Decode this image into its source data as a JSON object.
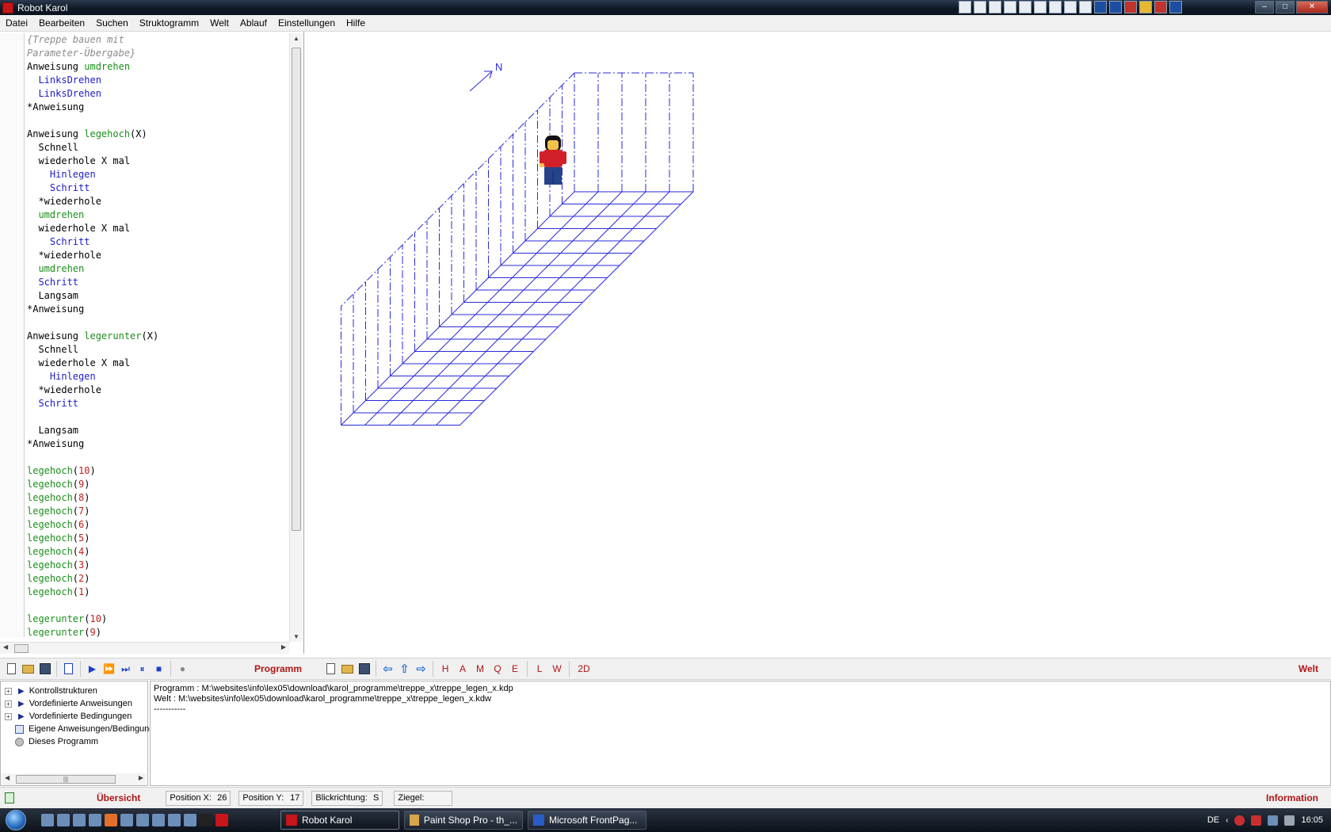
{
  "window": {
    "title": "Robot Karol"
  },
  "menu": [
    "Datei",
    "Bearbeiten",
    "Suchen",
    "Struktogramm",
    "Welt",
    "Ablauf",
    "Einstellungen",
    "Hilfe"
  ],
  "editor": {
    "lines": [
      [
        [
          "comment",
          "{Treppe bauen mit"
        ]
      ],
      [
        [
          "comment",
          "Parameter-Übergabe}"
        ]
      ],
      [
        [
          "kw",
          "Anweisung "
        ],
        [
          "name",
          "umdrehen"
        ]
      ],
      [
        [
          "kw",
          "  "
        ],
        [
          "cmd",
          "LinksDrehen"
        ]
      ],
      [
        [
          "kw",
          "  "
        ],
        [
          "cmd",
          "LinksDrehen"
        ]
      ],
      [
        [
          "kw",
          "*Anweisung"
        ]
      ],
      [],
      [
        [
          "kw",
          "Anweisung "
        ],
        [
          "name",
          "legehoch"
        ],
        [
          "kw",
          "(X)"
        ]
      ],
      [
        [
          "kw",
          "  Schnell"
        ]
      ],
      [
        [
          "kw",
          "  wiederhole X mal"
        ]
      ],
      [
        [
          "kw",
          "    "
        ],
        [
          "cmd",
          "Hinlegen"
        ]
      ],
      [
        [
          "kw",
          "    "
        ],
        [
          "cmd",
          "Schritt"
        ]
      ],
      [
        [
          "kw",
          "  *wiederhole"
        ]
      ],
      [
        [
          "kw",
          "  "
        ],
        [
          "name",
          "umdrehen"
        ]
      ],
      [
        [
          "kw",
          "  wiederhole X mal"
        ]
      ],
      [
        [
          "kw",
          "    "
        ],
        [
          "cmd",
          "Schritt"
        ]
      ],
      [
        [
          "kw",
          "  *wiederhole"
        ]
      ],
      [
        [
          "kw",
          "  "
        ],
        [
          "name",
          "umdrehen"
        ]
      ],
      [
        [
          "kw",
          "  "
        ],
        [
          "cmd",
          "Schritt"
        ]
      ],
      [
        [
          "kw",
          "  Langsam"
        ]
      ],
      [
        [
          "kw",
          "*Anweisung"
        ]
      ],
      [],
      [
        [
          "kw",
          "Anweisung "
        ],
        [
          "name",
          "legerunter"
        ],
        [
          "kw",
          "(X)"
        ]
      ],
      [
        [
          "kw",
          "  Schnell"
        ]
      ],
      [
        [
          "kw",
          "  wiederhole X mal"
        ]
      ],
      [
        [
          "kw",
          "    "
        ],
        [
          "cmd",
          "Hinlegen"
        ]
      ],
      [
        [
          "kw",
          "  *wiederhole"
        ]
      ],
      [
        [
          "kw",
          "  "
        ],
        [
          "cmd",
          "Schritt"
        ]
      ],
      [],
      [
        [
          "kw",
          "  Langsam"
        ]
      ],
      [
        [
          "kw",
          "*Anweisung"
        ]
      ],
      [],
      [
        [
          "name",
          "legehoch"
        ],
        [
          "kw",
          "("
        ],
        [
          "num",
          "10"
        ],
        [
          "kw",
          ")"
        ]
      ],
      [
        [
          "name",
          "legehoch"
        ],
        [
          "kw",
          "("
        ],
        [
          "num",
          "9"
        ],
        [
          "kw",
          ")"
        ]
      ],
      [
        [
          "name",
          "legehoch"
        ],
        [
          "kw",
          "("
        ],
        [
          "num",
          "8"
        ],
        [
          "kw",
          ")"
        ]
      ],
      [
        [
          "name",
          "legehoch"
        ],
        [
          "kw",
          "("
        ],
        [
          "num",
          "7"
        ],
        [
          "kw",
          ")"
        ]
      ],
      [
        [
          "name",
          "legehoch"
        ],
        [
          "kw",
          "("
        ],
        [
          "num",
          "6"
        ],
        [
          "kw",
          ")"
        ]
      ],
      [
        [
          "name",
          "legehoch"
        ],
        [
          "kw",
          "("
        ],
        [
          "num",
          "5"
        ],
        [
          "kw",
          ")"
        ]
      ],
      [
        [
          "name",
          "legehoch"
        ],
        [
          "kw",
          "("
        ],
        [
          "num",
          "4"
        ],
        [
          "kw",
          ")"
        ]
      ],
      [
        [
          "name",
          "legehoch"
        ],
        [
          "kw",
          "("
        ],
        [
          "num",
          "3"
        ],
        [
          "kw",
          ")"
        ]
      ],
      [
        [
          "name",
          "legehoch"
        ],
        [
          "kw",
          "("
        ],
        [
          "num",
          "2"
        ],
        [
          "kw",
          ")"
        ]
      ],
      [
        [
          "name",
          "legehoch"
        ],
        [
          "kw",
          "("
        ],
        [
          "num",
          "1"
        ],
        [
          "kw",
          ")"
        ]
      ],
      [],
      [
        [
          "name",
          "legerunter"
        ],
        [
          "kw",
          "("
        ],
        [
          "num",
          "10"
        ],
        [
          "kw",
          ")"
        ]
      ],
      [
        [
          "name",
          "legerunter"
        ],
        [
          "kw",
          "("
        ],
        [
          "num",
          "9"
        ],
        [
          "kw",
          ")"
        ]
      ]
    ]
  },
  "world": {
    "compass_label": "N",
    "grid_color": "#2a2ad8"
  },
  "toolbar": {
    "program_label": "Programm",
    "world_letters": [
      "H",
      "A",
      "M",
      "Q",
      "E",
      "L",
      "W",
      "2D"
    ],
    "world_label": "Welt"
  },
  "tree": {
    "items": [
      {
        "label": "Kontrollstrukturen",
        "expandable": true
      },
      {
        "label": "Vordefinierte Anweisungen",
        "expandable": true
      },
      {
        "label": "Vordefinierte Bedingungen",
        "expandable": true
      },
      {
        "label": "Eigene Anweisungen/Bedingungen",
        "expandable": false
      },
      {
        "label": "Dieses Programm",
        "expandable": false
      }
    ]
  },
  "output": {
    "lines": [
      "Programm : M:\\websites\\info\\lex05\\download\\karol_programme\\treppe_x\\treppe_legen_x.kdp",
      "Welt : M:\\websites\\info\\lex05\\download\\karol_programme\\treppe_x\\treppe_legen_x.kdw",
      "-----------"
    ]
  },
  "status": {
    "overview_label": "Übersicht",
    "pos_x_label": "Position X:",
    "pos_x_value": "26",
    "pos_y_label": "Position Y:",
    "pos_y_value": "17",
    "direction_label": "Blickrichtung:",
    "direction_value": "S",
    "bricks_label": "Ziegel:",
    "info_label": "Information"
  },
  "taskbar": {
    "tasks": [
      "Robot Karol",
      "Paint Shop Pro - th_...",
      "Microsoft FrontPag..."
    ],
    "lang": "DE",
    "clock": "16:05"
  }
}
